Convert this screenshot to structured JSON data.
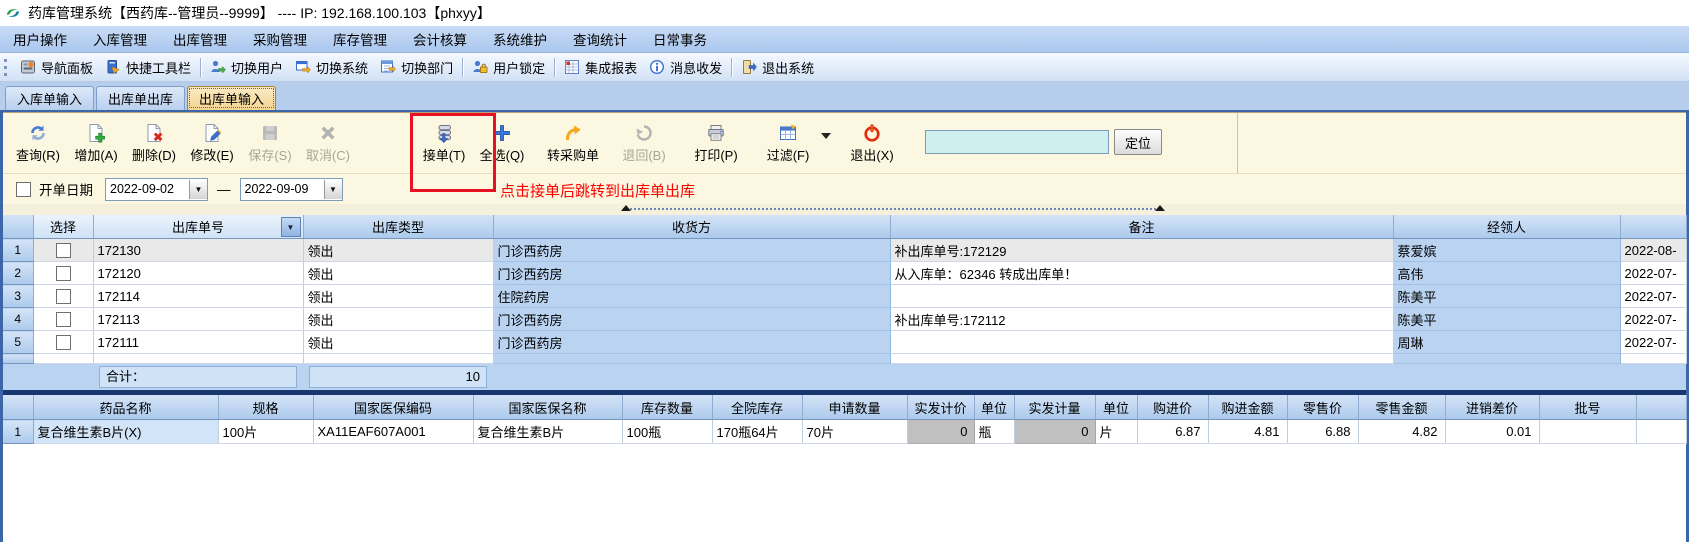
{
  "window": {
    "title": "药库管理系统【西药库--管理员--9999】 ---- IP: 192.168.100.103【phxyy】"
  },
  "menu_bar": {
    "items": [
      "用户操作",
      "入库管理",
      "出库管理",
      "采购管理",
      "库存管理",
      "会计核算",
      "系统维护",
      "查询统计",
      "日常事务"
    ]
  },
  "toolbar": {
    "groups": [
      [
        {
          "label": "导航面板",
          "icon": "nav-panel"
        },
        {
          "label": "快捷工具栏",
          "icon": "quick-toolbar"
        }
      ],
      [
        {
          "label": "切换用户",
          "icon": "switch-user"
        },
        {
          "label": "切换系统",
          "icon": "switch-system"
        },
        {
          "label": "切换部门",
          "icon": "switch-dept"
        }
      ],
      [
        {
          "label": "用户锁定",
          "icon": "user-lock"
        }
      ],
      [
        {
          "label": "集成报表",
          "icon": "report"
        },
        {
          "label": "消息收发",
          "icon": "message"
        }
      ],
      [
        {
          "label": "退出系统",
          "icon": "exit-system"
        }
      ]
    ]
  },
  "tab_bar": {
    "tabs": [
      {
        "label": "入库单输入",
        "active": false
      },
      {
        "label": "出库单出库",
        "active": false
      },
      {
        "label": "出库单输入",
        "active": true
      }
    ]
  },
  "action_toolbar": {
    "buttons": [
      {
        "label": "查询(R)",
        "icon": "refresh",
        "enabled": true
      },
      {
        "label": "增加(A)",
        "icon": "add",
        "enabled": true
      },
      {
        "label": "删除(D)",
        "icon": "delete",
        "enabled": true
      },
      {
        "label": "修改(E)",
        "icon": "edit",
        "enabled": true
      },
      {
        "label": "保存(S)",
        "icon": "save",
        "enabled": false
      },
      {
        "label": "取消(C)",
        "icon": "cancel",
        "enabled": false
      },
      {
        "label": "接单(T)",
        "icon": "accept",
        "enabled": true,
        "highlighted": true
      },
      {
        "label": "全选(Q)",
        "icon": "select-all",
        "enabled": true
      },
      {
        "label": "转采购单",
        "icon": "to-purchase",
        "enabled": true
      },
      {
        "label": "退回(B)",
        "icon": "return",
        "enabled": false
      },
      {
        "label": "打印(P)",
        "icon": "print",
        "enabled": true
      },
      {
        "label": "过滤(F)",
        "icon": "filter",
        "enabled": true,
        "dropdown": true
      },
      {
        "label": "退出(X)",
        "icon": "exit",
        "enabled": true
      }
    ],
    "locate_value": "",
    "locate_button": "定位"
  },
  "filter_row": {
    "label": "开单日期",
    "checked": false,
    "date_from": "2022-09-02",
    "dash": "—",
    "date_to": "2022-09-09"
  },
  "annotation": {
    "text": "点击接单后跳转到出库单出库",
    "color": "#ff0000"
  },
  "orders_table": {
    "columns": [
      "",
      "选择",
      "出库单号",
      "出库类型",
      "收货方",
      "备注",
      "经领人",
      ""
    ],
    "rows": [
      {
        "num": "1",
        "checked": false,
        "order_no": "172130",
        "type": "领出",
        "receiver": "门诊西药房",
        "remark": "补出库单号:172129",
        "handler": "蔡爱嫔",
        "date": "2022-08-"
      },
      {
        "num": "2",
        "checked": false,
        "order_no": "172120",
        "type": "领出",
        "receiver": "门诊西药房",
        "remark": "从入库单：62346 转成出库单！",
        "handler": "高伟",
        "date": "2022-07-"
      },
      {
        "num": "3",
        "checked": false,
        "order_no": "172114",
        "type": "领出",
        "receiver": "住院药房",
        "remark": "",
        "handler": "陈美平",
        "date": "2022-07-"
      },
      {
        "num": "4",
        "checked": false,
        "order_no": "172113",
        "type": "领出",
        "receiver": "门诊西药房",
        "remark": "补出库单号:172112",
        "handler": "陈美平",
        "date": "2022-07-"
      },
      {
        "num": "5",
        "checked": false,
        "order_no": "172111",
        "type": "领出",
        "receiver": "门诊西药房",
        "remark": "",
        "handler": "周琳",
        "date": "2022-07-"
      }
    ],
    "summary": {
      "label": "合计：",
      "value": "10"
    }
  },
  "details_table": {
    "columns": [
      "",
      "药品名称",
      "规格",
      "国家医保编码",
      "国家医保名称",
      "库存数量",
      "全院库存",
      "申请数量",
      "实发计价",
      "单位",
      "实发计量",
      "单位",
      "购进价",
      "购进金额",
      "零售价",
      "零售金额",
      "进销差价",
      "批号",
      ""
    ],
    "rows": [
      {
        "num": "1",
        "name": "复合维生素B片(X)",
        "spec": "100片",
        "nhsa_code": "XA11EAF607A001",
        "nhsa_name": "复合维生素B片",
        "stock_qty": "100瓶",
        "hospital_stock": "170瓶64片",
        "request_qty": "70片",
        "issue_price_qty": "0",
        "issue_price_unit": "瓶",
        "issue_count_qty": "0",
        "issue_count_unit": "片",
        "purchase_price": "6.87",
        "purchase_amount": "4.81",
        "retail_price": "6.88",
        "retail_amount": "4.82",
        "price_diff": "0.01",
        "batch_no": ""
      }
    ]
  },
  "colors": {
    "highlight_red": "#e81123",
    "annotation_red": "#ff0000",
    "panel_yellow": "#fbf7e0",
    "grid_blue_column": "#b9d3f1",
    "header_blue": "#accaec",
    "disabled_gray": "#c0c0c0"
  }
}
